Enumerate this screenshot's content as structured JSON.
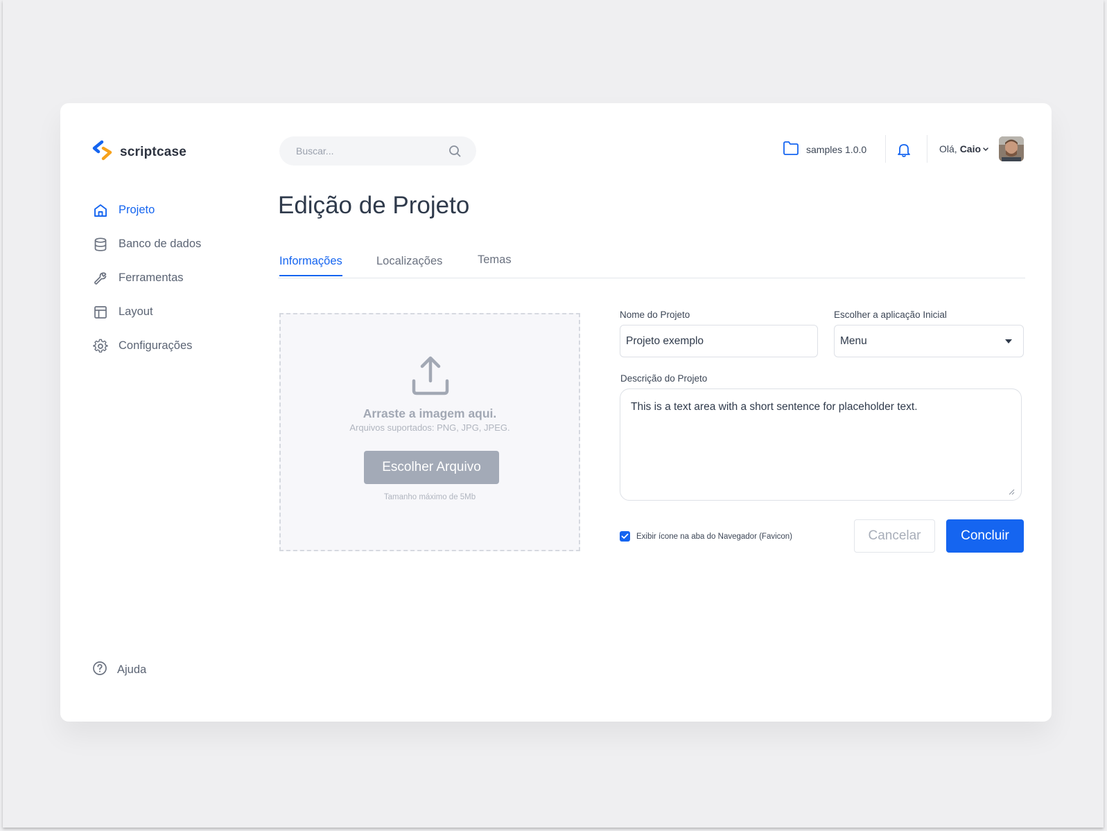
{
  "brand": {
    "name": "scriptcase",
    "colors": {
      "blue": "#1565f0",
      "orange": "#f7a21b"
    }
  },
  "search": {
    "placeholder": "Buscar...",
    "icon": "search-icon"
  },
  "header": {
    "project": {
      "icon": "folder-icon",
      "label": "samples 1.0.0"
    },
    "notifications_icon": "bell-icon",
    "greeting": "Olá,",
    "user_name": "Caio"
  },
  "sidebar": {
    "items": [
      {
        "label": "Projeto",
        "icon": "home-icon",
        "active": true
      },
      {
        "label": "Banco de dados",
        "icon": "database-icon"
      },
      {
        "label": "Ferramentas",
        "icon": "wrench-icon"
      },
      {
        "label": "Layout",
        "icon": "layout-icon"
      },
      {
        "label": "Configurações",
        "icon": "gear-icon"
      }
    ],
    "help": {
      "label": "Ajuda",
      "icon": "help-circle-icon"
    }
  },
  "page": {
    "title": "Edição de Projeto",
    "tabs": [
      {
        "label": "Informações",
        "active": true
      },
      {
        "label": "Localizações"
      },
      {
        "label": "Temas"
      }
    ]
  },
  "upload": {
    "title": "Arraste a imagem aqui.",
    "supported": "Arquivos suportados: PNG, JPG, JPEG.",
    "button": "Escolher Arquivo",
    "max_size": "Tamanho máximo de 5Mb"
  },
  "form": {
    "name_label": "Nome do Projeto",
    "name_value": "Projeto exemplo",
    "app_label": "Escolher a aplicação Inicial",
    "app_value": "Menu",
    "desc_label": "Descrição do Projeto",
    "desc_value": "This is a text area with a short sentence for placeholder text.",
    "favicon_label": "Exibir ícone na aba do Navegador (Favicon)",
    "favicon_checked": true,
    "cancel": "Cancelar",
    "submit": "Concluir"
  }
}
